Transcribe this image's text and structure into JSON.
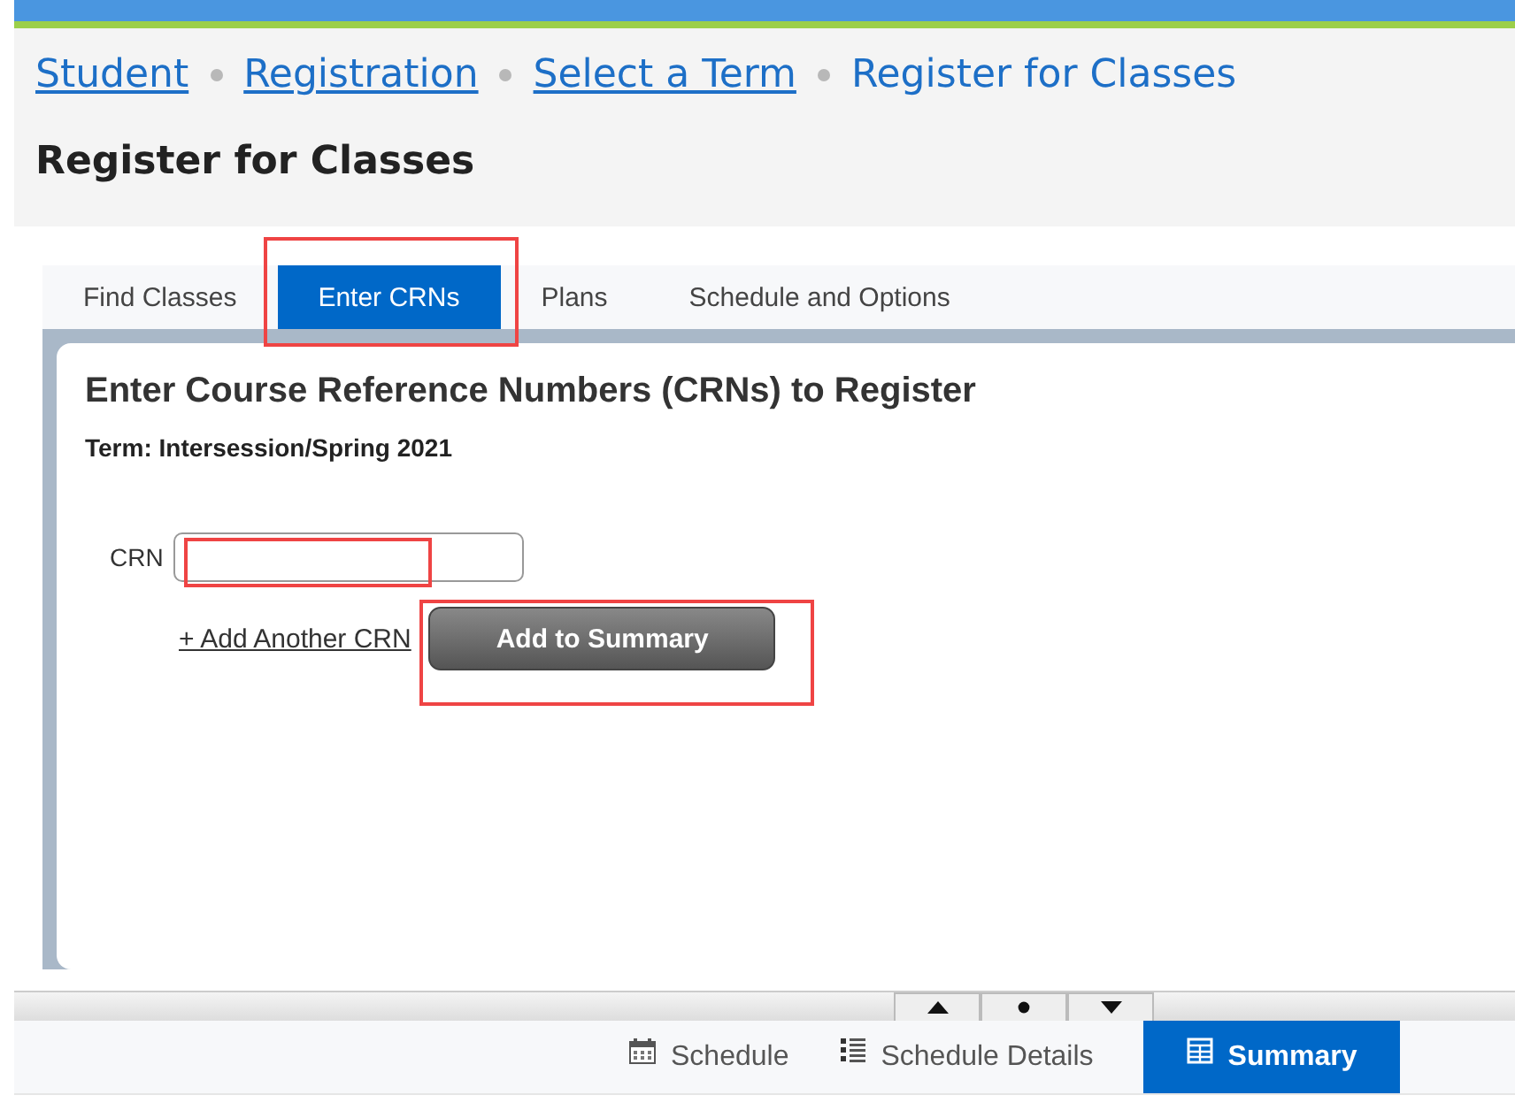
{
  "breadcrumb": [
    {
      "label": "Student",
      "link": true
    },
    {
      "label": "Registration",
      "link": true
    },
    {
      "label": "Select a Term",
      "link": true
    },
    {
      "label": "Register for Classes",
      "link": false
    }
  ],
  "page_title": "Register for Classes",
  "tabs": [
    {
      "label": "Find Classes",
      "selected": false,
      "highlighted": false
    },
    {
      "label": "Enter CRNs",
      "selected": true,
      "highlighted": true
    },
    {
      "label": "Plans",
      "selected": false,
      "highlighted": false
    },
    {
      "label": "Schedule and Options",
      "selected": false,
      "highlighted": false
    }
  ],
  "panel": {
    "heading": "Enter Course Reference Numbers (CRNs) to Register",
    "term": "Term: Intersession/Spring 2021",
    "crn_field": {
      "label": "CRN",
      "highlighted": true
    },
    "add_link": "+ Add Another CRN",
    "submit_button": {
      "label": "Add to Summary",
      "highlighted": true
    }
  },
  "bottom_tabs": [
    {
      "label": "Schedule",
      "selected": false
    },
    {
      "label": "Schedule Details",
      "selected": false
    },
    {
      "label": "Summary",
      "selected": true
    }
  ]
}
